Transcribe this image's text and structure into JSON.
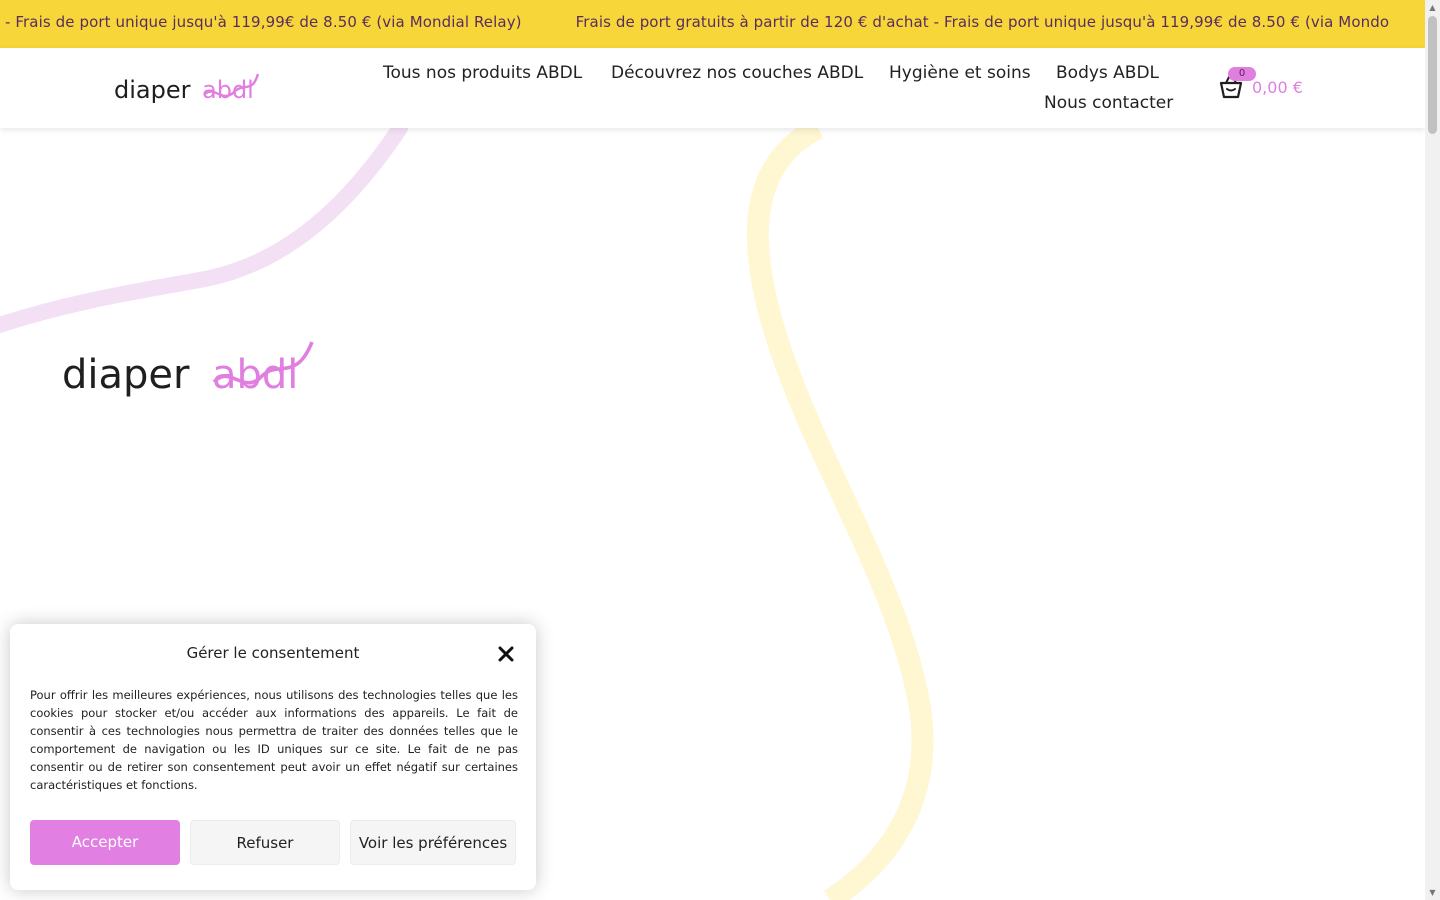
{
  "ticker": {
    "items": [
      "- Frais de port unique jusqu'à 119,99€ de 8.50 € (via Mondial Relay)",
      "Frais de port gratuits à partir de 120 € d'achat - Frais de port unique jusqu'à 119,99€ de 8.50 € (via Mondo"
    ],
    "background": "#f7d63a",
    "text_color": "#5b2d5e"
  },
  "header": {
    "logo": {
      "text_dark": "diaper",
      "text_accent": "abdl",
      "icon": "diaperabdl-logo"
    },
    "nav": [
      {
        "label": "Tous nos produits ABDL"
      },
      {
        "label": "Découvrez nos couches ABDL"
      },
      {
        "label": "Hygiène et soins"
      },
      {
        "label": "Bodys ABDL"
      },
      {
        "label": "Nous contacter"
      }
    ],
    "cart": {
      "icon": "basket-icon",
      "count": "0",
      "total": "0,00 €"
    }
  },
  "hero": {
    "logo": {
      "text_dark": "diaper",
      "text_accent": "abdl"
    },
    "decor_colors": {
      "pink": "#f3e0f5",
      "yellow": "#fff6d2"
    }
  },
  "consent": {
    "title": "Gérer le consentement",
    "close_icon": "close-icon",
    "text": "Pour offrir les meilleures expériences, nous utilisons des technologies telles que les cookies pour stocker et/ou accéder aux informations des appareils. Le fait de consentir à ces technologies nous permettra de traiter des données telles que le comportement de navigation ou les ID uniques sur ce site. Le fait de ne pas consentir ou de retirer son consentement peut avoir un effet négatif sur certaines caractéristiques et fonctions.",
    "buttons": {
      "accept": "Accepter",
      "refuse": "Refuser",
      "preferences": "Voir les préférences"
    }
  },
  "colors": {
    "accent": "#e07fe0",
    "brand_yellow": "#f7d63a",
    "text": "#1f1f1f"
  }
}
